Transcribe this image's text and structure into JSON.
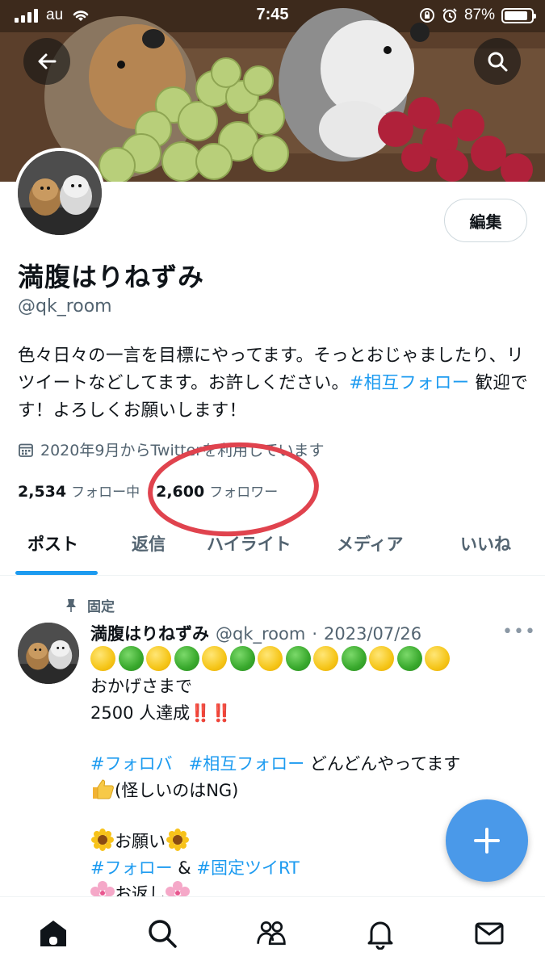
{
  "status_bar": {
    "carrier": "au",
    "time": "7:45",
    "battery": "87%",
    "battery_level": 0.87
  },
  "profile": {
    "display_name": "満腹はりねずみ",
    "handle": "@qk_room",
    "edit_label": "編集",
    "bio": {
      "text1": "色々日々の一言を目標にやってます。そっとおじゃましたり、リツイートなどしてます。お許しください。",
      "hashtag": "#相互フォロー",
      "text2": " 歓迎です！よろしくお願いします！"
    },
    "joined": "2020年9月からTwitterを利用しています",
    "following_count": "2,534",
    "following_label": "フォロー中",
    "followers_count": "2,600",
    "followers_label": "フォロワー"
  },
  "tabs": [
    {
      "label": "ポスト",
      "active": true
    },
    {
      "label": "返信",
      "active": false
    },
    {
      "label": "ハイライト",
      "active": false
    },
    {
      "label": "メディア",
      "active": false
    },
    {
      "label": "いいね",
      "active": false
    }
  ],
  "pinned_post": {
    "pinned_label": "固定",
    "author": "満腹はりねずみ",
    "handle": "@qk_room",
    "separator": "·",
    "date": "2023/07/26",
    "more": "•••",
    "dot_pattern": [
      "yellow",
      "green",
      "yellow",
      "green",
      "yellow",
      "green",
      "yellow",
      "green",
      "yellow",
      "green",
      "yellow",
      "green",
      "yellow"
    ],
    "line1": "おかげさまで",
    "line2_text": "2500 人達成",
    "line2_marks": "‼️‼️",
    "hashtag1": "#フォロバ",
    "hashtag2": "#相互フォロー",
    "line3_text": " どんどんやってます",
    "line4_text": "(怪しいのはNG)",
    "line5_text": "お願い",
    "hashtag3": "#フォロー",
    "amp": " & ",
    "hashtag4": "#固定ツイRT",
    "line7_text": "お返し"
  },
  "colors": {
    "accent": "#1d9bf0",
    "fab": "#4a99e9",
    "highlight_ring": "#e0434e"
  },
  "icons": {
    "top_left": "back-arrow-icon",
    "top_right": "search-icon",
    "nav": [
      "home-icon",
      "search-icon",
      "communities-icon",
      "notifications-icon",
      "messages-icon"
    ]
  }
}
